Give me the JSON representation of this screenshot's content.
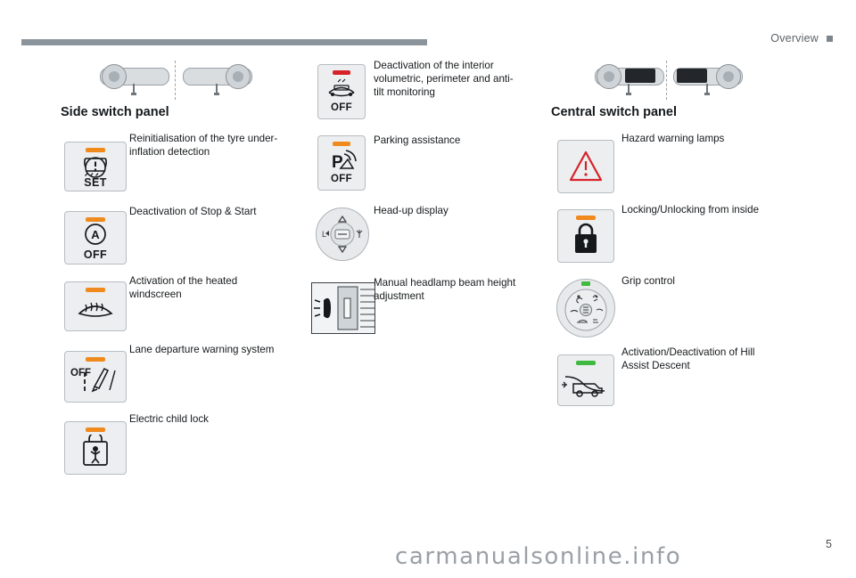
{
  "header": {
    "section_label": "Overview",
    "page_number": "5",
    "watermark": "carmanualsonline.info"
  },
  "sections": [
    {
      "id": "side",
      "title": "Side switch panel",
      "items": [
        {
          "id": "tyre-pressure",
          "caption": "Reinitialisation of the tyre under-\ninflation detection",
          "button_text": "SET",
          "led": "orange"
        },
        {
          "id": "stop-start",
          "caption": "Deactivation of Stop & Start",
          "button_text": "OFF",
          "led": "orange"
        },
        {
          "id": "heated-windscreen",
          "caption": "Activation of the heated\nwindscreen",
          "button_text": "",
          "led": "orange"
        },
        {
          "id": "lane-departure",
          "caption": "Lane departure warning system",
          "button_text": "OFF",
          "led": "orange"
        },
        {
          "id": "electric-child-lock",
          "caption": "Electric child lock",
          "button_text": "",
          "led": "orange"
        }
      ]
    },
    {
      "id": "middle",
      "title": "",
      "items": [
        {
          "id": "alarm-deactivation",
          "caption": "Deactivation of the interior\nvolumetric, perimeter and anti-\ntilt monitoring",
          "button_text": "OFF",
          "led": "red"
        },
        {
          "id": "parking-assistance",
          "caption": "Parking assistance",
          "button_text": "OFF",
          "led": "orange"
        },
        {
          "id": "head-up-display",
          "caption": "Head-up display",
          "button_text": "",
          "led": "none"
        },
        {
          "id": "headlamp-beam-height",
          "caption": "Manual headlamp beam height\nadjustment",
          "button_text": "",
          "led": "none"
        }
      ]
    },
    {
      "id": "central",
      "title": "Central switch panel",
      "items": [
        {
          "id": "hazard-warning-lamps",
          "caption": "Hazard warning lamps",
          "button_text": "",
          "led": "none"
        },
        {
          "id": "central-locking",
          "caption": "Locking/Unlocking from inside",
          "button_text": "",
          "led": "orange"
        },
        {
          "id": "grip-control",
          "caption": "Grip control",
          "button_text": "",
          "led": "green"
        },
        {
          "id": "hill-assist-descent",
          "caption": "Activation/Deactivation of Hill\nAssist Descent",
          "button_text": "",
          "led": "green"
        }
      ]
    }
  ],
  "colors": {
    "led_orange": "#f08a1c",
    "led_red": "#d6232a",
    "led_green": "#3fb93f",
    "rule": "#8b949a",
    "button_face": "#eceeef"
  }
}
